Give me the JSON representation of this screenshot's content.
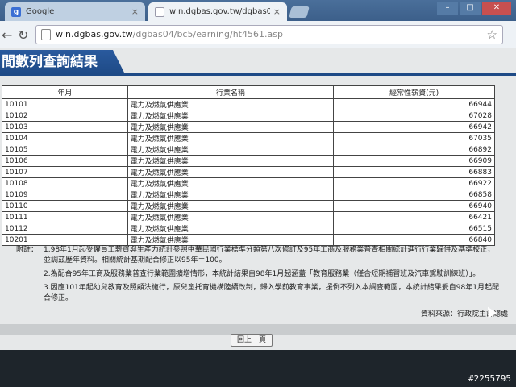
{
  "browser": {
    "tabs": [
      {
        "title": "Google",
        "icon": "google-icon"
      },
      {
        "title": "win.dgbas.gov.tw/dgbas04/bc",
        "icon": "page-icon"
      }
    ],
    "url_domain": "win.dgbas.gov.tw",
    "url_path": "/dgbas04/bc5/earning/ht4561.asp"
  },
  "page": {
    "title": "間數列查詢結果",
    "table": {
      "headers": [
        "年月",
        "行業名稱",
        "經常性薪資(元)"
      ],
      "rows": [
        [
          "10101",
          "電力及燃氣供應業",
          "66944"
        ],
        [
          "10102",
          "電力及燃氣供應業",
          "67028"
        ],
        [
          "10103",
          "電力及燃氣供應業",
          "66942"
        ],
        [
          "10104",
          "電力及燃氣供應業",
          "67035"
        ],
        [
          "10105",
          "電力及燃氣供應業",
          "66892"
        ],
        [
          "10106",
          "電力及燃氣供應業",
          "66909"
        ],
        [
          "10107",
          "電力及燃氣供應業",
          "66883"
        ],
        [
          "10108",
          "電力及燃氣供應業",
          "66922"
        ],
        [
          "10109",
          "電力及燃氣供應業",
          "66858"
        ],
        [
          "10110",
          "電力及燃氣供應業",
          "66940"
        ],
        [
          "10111",
          "電力及燃氣供應業",
          "66421"
        ],
        [
          "10112",
          "電力及燃氣供應業",
          "66515"
        ],
        [
          "10201",
          "電力及燃氣供應業",
          "66840"
        ]
      ]
    },
    "notes_label": "附註：",
    "notes": [
      "1.98年1月起受僱員工薪資與生產力統計參照中華民國行業標準分類第八次修訂及95年工商及服務業普查相關統計進行行業歸併及基準校正，並調茲歷年資料。相關統計基期配合修正以95年＝100。",
      "2.為配合95年工商及服務業普查行業範圍擴增情形，本統計結果自98年1月起涵蓋「教育服務業（僅含短期補習班及汽車駕駛訓練班）」。",
      "3.因應101年起幼兒教育及照顧法施行，原兒童托育機構陸續改制，歸入學前教育事業，援例不列入本調查範圍，本統計結果爰自98年1月起配合修正。"
    ],
    "source": "資料來源：行政院主計總處",
    "back_button": "回上一頁"
  },
  "watermark": "#2255795"
}
